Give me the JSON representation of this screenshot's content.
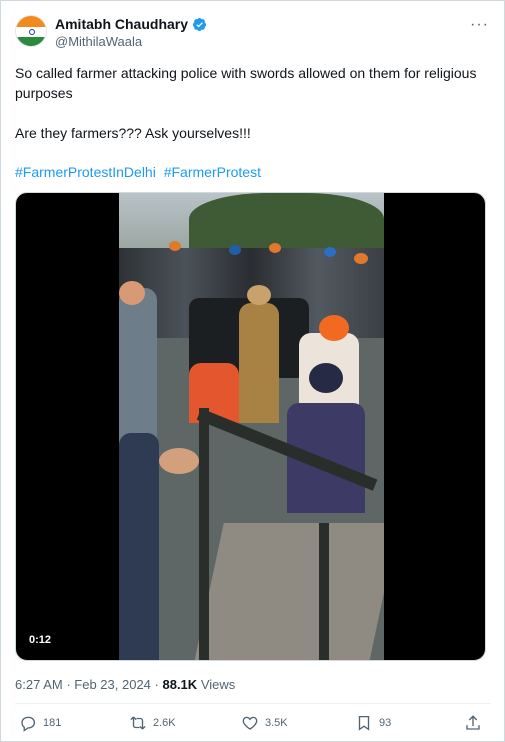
{
  "author": {
    "display_name": "Amitabh Chaudhary",
    "handle": "@MithilaWaala"
  },
  "tweet": {
    "text_line1": "So called farmer attacking police with swords allowed on them for religious purposes",
    "text_line2": "Are they farmers??? Ask yourselves!!!",
    "hashtags": [
      "#FarmerProtestInDelhi",
      "#FarmerProtest"
    ]
  },
  "media": {
    "duration": "0:12"
  },
  "meta": {
    "time": "6:27 AM",
    "date": "Feb 23, 2024",
    "views_count": "88.1K",
    "views_label": "Views"
  },
  "actions": {
    "replies": "181",
    "reposts": "2.6K",
    "likes": "3.5K",
    "bookmarks": "93"
  },
  "colors": {
    "link": "#1d9bf0",
    "secondary_text": "#536471",
    "verified": "#1d9bf0"
  }
}
